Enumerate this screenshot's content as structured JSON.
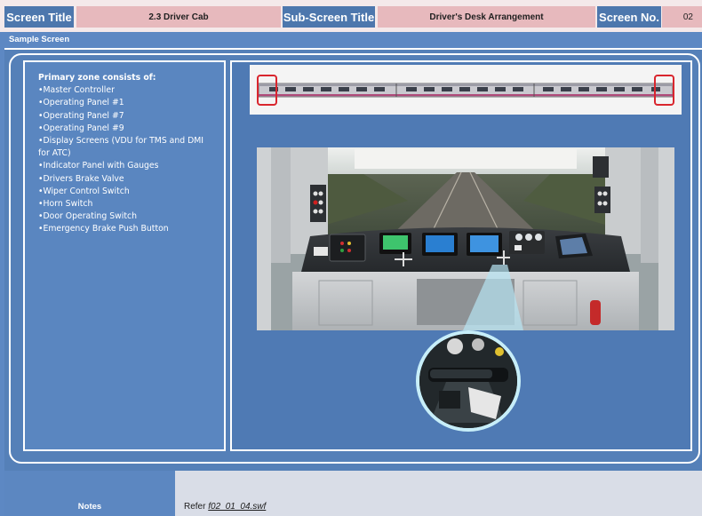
{
  "header": {
    "screen_title_label": "Screen Title",
    "screen_title_value": "2.3 Driver Cab",
    "sub_screen_title_label": "Sub-Screen Title",
    "sub_screen_title_value": "Driver's Desk Arrangement",
    "screen_no_label": "Screen No.",
    "screen_no_value": "02"
  },
  "section_label": "Sample Screen",
  "primary_zone": {
    "heading": "Primary zone consists of:",
    "items": [
      "•Master Controller",
      "•Operating Panel #1",
      "•Operating Panel #7",
      "•Operating Panel #9",
      "•Display Screens (VDU for TMS and DMI for ATC)",
      "•Indicator Panel with Gauges",
      "•Drivers Brake Valve",
      "•Wiper Control Switch",
      "•Horn Switch",
      "•Door Operating Switch",
      "•Emergency Brake Push Button"
    ]
  },
  "notes": {
    "label": "Notes",
    "prefix": "Refer ",
    "file": "f02_01_04.swf"
  },
  "colors": {
    "header_blue": "#4d77ad",
    "header_pink": "#e7b9bd",
    "panel_blue": "#5580b8",
    "highlight_red": "#d9262e"
  }
}
